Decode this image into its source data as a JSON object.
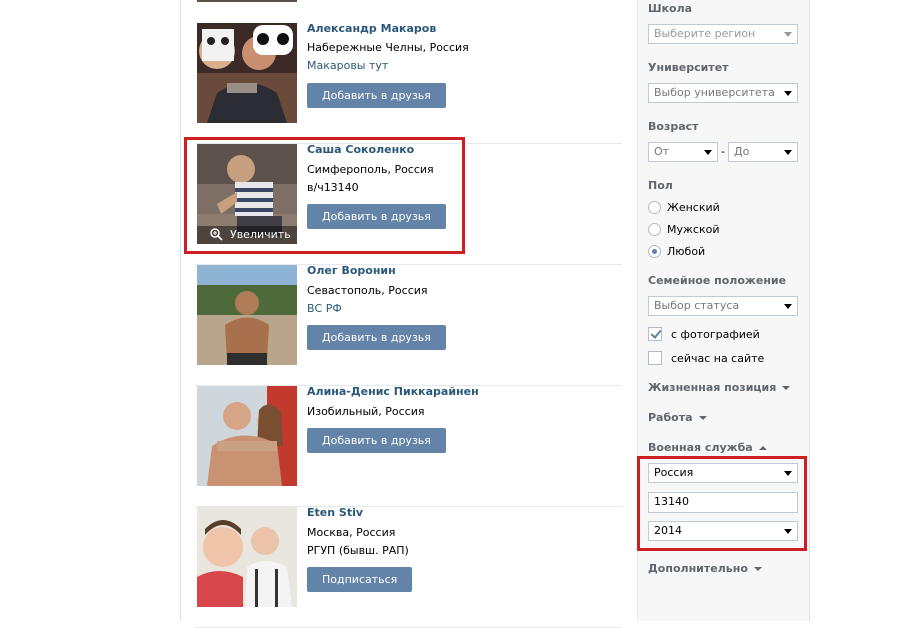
{
  "people": [
    {
      "name": "Александр Макаров",
      "city": "Набережные Челны, Россия",
      "extra": "Макаровы тут",
      "button": "Добавить в друзья"
    },
    {
      "name": "Саша Соколенко",
      "city": "Симферополь, Россия",
      "extra": "в/ч13140",
      "button": "Добавить в друзья",
      "zoom": "Увеличить"
    },
    {
      "name": "Олег Воронин",
      "city": "Севастополь, Россия",
      "extra": "ВС РФ",
      "button": "Добавить в друзья"
    },
    {
      "name": "Алина-Денис Пиккарайнен",
      "city": "Изобильный, Россия",
      "button": "Добавить в друзья"
    },
    {
      "name": "Eten Stiv",
      "city": "Москва, Россия",
      "extra": "РГУП (бывш. РАП)",
      "button": "Подписаться"
    }
  ],
  "filters": {
    "school_label": "Школа",
    "region_placeholder": "Выберите регион",
    "university_label": "Университет",
    "university_placeholder": "Выбор университета",
    "age_label": "Возраст",
    "age_from": "От",
    "age_sep": "-",
    "age_to": "До",
    "sex_label": "Пол",
    "sex_options": [
      "Женский",
      "Мужской",
      "Любой"
    ],
    "sex_selected": "Любой",
    "marital_label": "Семейное положение",
    "marital_placeholder": "Выбор статуса",
    "with_photo": "с фотографией",
    "with_photo_checked": true,
    "online_now": "сейчас на сайте",
    "online_now_checked": false,
    "life_position": "Жизненная позиция",
    "work": "Работа",
    "military": "Военная служба",
    "military_country": "Россия",
    "military_unit": "13140",
    "military_year": "2014",
    "additional": "Дополнительно"
  },
  "colors": {
    "accent": "#2b587a",
    "button": "#6383a8",
    "highlight": "#cc1f24",
    "sidebar_bg": "#f7f7f7"
  }
}
